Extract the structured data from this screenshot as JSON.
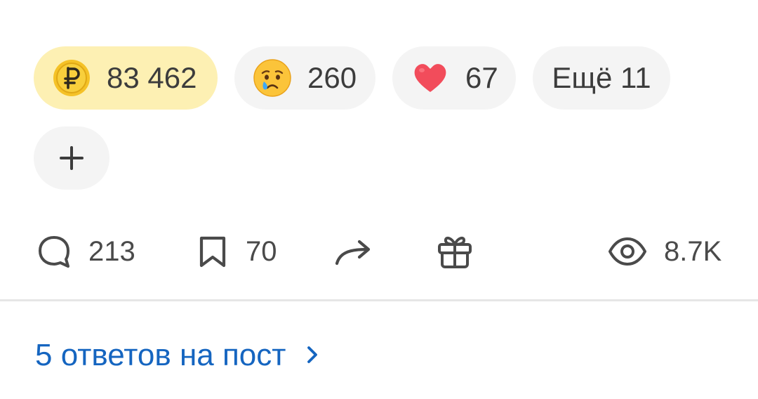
{
  "reactions": {
    "coins": {
      "icon": "ruble-coin-icon",
      "count": "83 462",
      "color": "#fdf0b3"
    },
    "cry": {
      "icon": "crying-face-icon",
      "count": "260"
    },
    "heart": {
      "icon": "heart-icon",
      "count": "67"
    },
    "more_label": "Ещё 11",
    "add_icon": "plus-icon"
  },
  "actions": {
    "comments": {
      "icon": "comment-icon",
      "count": "213"
    },
    "bookmarks": {
      "icon": "bookmark-icon",
      "count": "70"
    },
    "share": {
      "icon": "share-arrow-icon"
    },
    "gift": {
      "icon": "gift-icon"
    },
    "views": {
      "icon": "eye-icon",
      "count": "8.7K"
    }
  },
  "replies": {
    "label": "5 ответов на пост",
    "icon": "chevron-right-icon",
    "color": "#1565c0"
  }
}
